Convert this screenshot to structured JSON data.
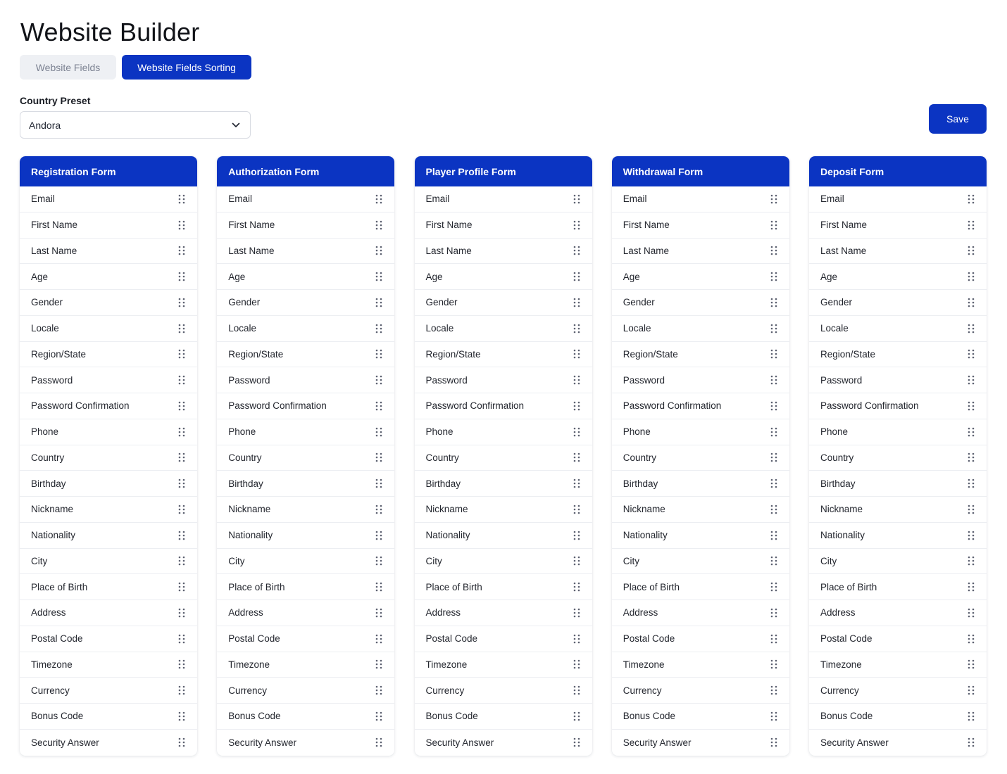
{
  "page": {
    "title": "Website Builder"
  },
  "tabs": [
    {
      "label": "Website Fields",
      "active": false
    },
    {
      "label": "Website Fields Sorting",
      "active": true
    }
  ],
  "country_preset": {
    "label": "Country Preset",
    "selected": "Andora",
    "icon": "chevron-down-icon"
  },
  "save": {
    "label": "Save"
  },
  "colors": {
    "accent": "#0b34c2",
    "tab_inactive_bg": "#eef0f4",
    "tab_inactive_text": "#7c8292"
  },
  "forms": [
    {
      "title": "Registration Form",
      "fields": [
        "Email",
        "First Name",
        "Last Name",
        "Age",
        "Gender",
        "Locale",
        "Region/State",
        "Password",
        "Password Confirmation",
        "Phone",
        "Country",
        "Birthday",
        "Nickname",
        "Nationality",
        "City",
        "Place of Birth",
        "Address",
        "Postal Code",
        "Timezone",
        "Currency",
        "Bonus Code",
        "Security Answer"
      ]
    },
    {
      "title": "Authorization Form",
      "fields": [
        "Email",
        "First Name",
        "Last Name",
        "Age",
        "Gender",
        "Locale",
        "Region/State",
        "Password",
        "Password Confirmation",
        "Phone",
        "Country",
        "Birthday",
        "Nickname",
        "Nationality",
        "City",
        "Place of Birth",
        "Address",
        "Postal Code",
        "Timezone",
        "Currency",
        "Bonus Code",
        "Security Answer"
      ]
    },
    {
      "title": "Player Profile Form",
      "fields": [
        "Email",
        "First Name",
        "Last Name",
        "Age",
        "Gender",
        "Locale",
        "Region/State",
        "Password",
        "Password Confirmation",
        "Phone",
        "Country",
        "Birthday",
        "Nickname",
        "Nationality",
        "City",
        "Place of Birth",
        "Address",
        "Postal Code",
        "Timezone",
        "Currency",
        "Bonus Code",
        "Security Answer"
      ]
    },
    {
      "title": "Withdrawal Form",
      "fields": [
        "Email",
        "First Name",
        "Last Name",
        "Age",
        "Gender",
        "Locale",
        "Region/State",
        "Password",
        "Password Confirmation",
        "Phone",
        "Country",
        "Birthday",
        "Nickname",
        "Nationality",
        "City",
        "Place of Birth",
        "Address",
        "Postal Code",
        "Timezone",
        "Currency",
        "Bonus Code",
        "Security Answer"
      ]
    },
    {
      "title": "Deposit Form",
      "fields": [
        "Email",
        "First Name",
        "Last Name",
        "Age",
        "Gender",
        "Locale",
        "Region/State",
        "Password",
        "Password Confirmation",
        "Phone",
        "Country",
        "Birthday",
        "Nickname",
        "Nationality",
        "City",
        "Place of Birth",
        "Address",
        "Postal Code",
        "Timezone",
        "Currency",
        "Bonus Code",
        "Security Answer"
      ]
    }
  ]
}
